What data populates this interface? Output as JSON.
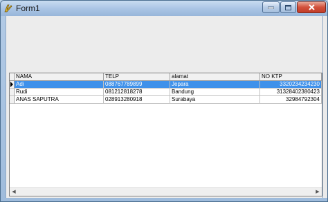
{
  "window": {
    "title": "Form1",
    "icons": {
      "app": "app-icon",
      "minimize": "minimize-icon",
      "maximize": "maximize-icon",
      "close": "close-icon"
    }
  },
  "grid": {
    "columns": [
      "NAMA",
      "TELP",
      "alamat",
      "NO KTP"
    ],
    "rows": [
      [
        "Adi",
        "088767789899",
        "Jepara",
        "3320234234230"
      ],
      [
        "Rudi",
        "081212818278",
        "Bandung",
        "31328402380423"
      ],
      [
        "ANAS SAPUTRA",
        "028913280918",
        "Surabaya",
        "32984792304"
      ]
    ],
    "selected_row": 0,
    "colors": {
      "selection": "#3f91ea",
      "header": "#f1f1f1"
    }
  }
}
